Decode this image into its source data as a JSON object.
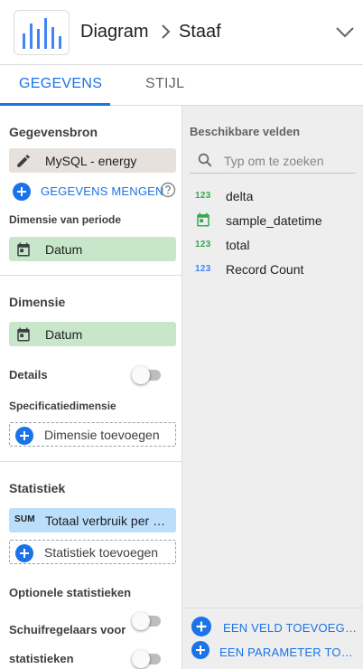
{
  "header": {
    "breadcrumb": [
      "Diagram",
      "Staaf"
    ],
    "logo_icon": "bar-chart-icon",
    "menu_icon": "chevron-down-icon"
  },
  "tabs": [
    {
      "label": "GEGEVENS",
      "active": true
    },
    {
      "label": "STIJL",
      "active": false
    }
  ],
  "data_panel": {
    "source_section": {
      "label": "Gegevensbron",
      "source_name": "MySQL - energy",
      "source_icon": "pencil-icon",
      "blend_label": "GEGEVENS MENGEN"
    },
    "period_dimension": {
      "label": "Dimensie van periode",
      "value": "Datum"
    },
    "dimension_section": {
      "label": "Dimensie",
      "value": "Datum",
      "details_label": "Details",
      "details_enabled": false,
      "breakdown_label": "Specificatiedimensie",
      "add_dimension_label": "Dimensie toevoegen"
    },
    "metric_section": {
      "label": "Statistiek",
      "aggregation": "SUM",
      "metric_value": "Totaal verbruik per dag",
      "add_metric_label": "Statistiek toevoegen",
      "optional_metrics_label": "Optionele statistieken",
      "optional_metrics_enabled": false,
      "sliders_label_line1": "Schuifregelaars voor",
      "sliders_label_line2": "statistieken",
      "sliders_enabled": false
    }
  },
  "fields_panel": {
    "title": "Beschikbare velden",
    "search_placeholder": "Typ om te zoeken",
    "fields": [
      {
        "type_badge": "123",
        "name": "delta",
        "kind": "metric-number"
      },
      {
        "type_badge": "date",
        "name": "sample_datetime",
        "kind": "date"
      },
      {
        "type_badge": "123",
        "name": "total",
        "kind": "metric-number"
      },
      {
        "type_badge": "123",
        "name": "Record Count",
        "kind": "record-count"
      }
    ],
    "add_field_label": "EEN VELD TOEVOEGEN",
    "add_parameter_label": "EEN PARAMETER TOEVOEGEN"
  },
  "colors": {
    "accent": "#1a73e8",
    "source_chip": "#e6e1dc",
    "dimension_chip": "#c8e6c9",
    "metric_chip": "#bbdefb",
    "number_type": "#34a853",
    "record_count_type": "#4285f4",
    "panel_bg": "#eeeeee"
  }
}
